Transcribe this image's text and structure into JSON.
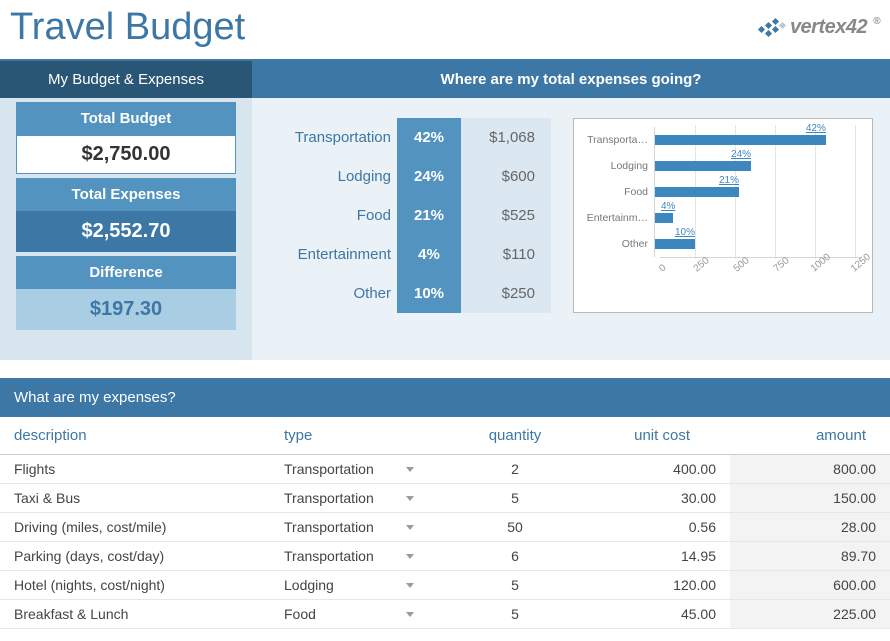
{
  "title": "Travel Budget",
  "logo_text": "vertex42",
  "summary": {
    "panel_title": "My Budget & Expenses",
    "budget_label": "Total Budget",
    "budget_value": "$2,750.00",
    "expenses_label": "Total Expenses",
    "expenses_value": "$2,552.70",
    "difference_label": "Difference",
    "difference_value": "$197.30"
  },
  "breakdown": {
    "title": "Where are my total expenses going?",
    "rows": [
      {
        "label": "Transportation",
        "pct": "42%",
        "amount": "$1,068"
      },
      {
        "label": "Lodging",
        "pct": "24%",
        "amount": "$600"
      },
      {
        "label": "Food",
        "pct": "21%",
        "amount": "$525"
      },
      {
        "label": "Entertainment",
        "pct": "4%",
        "amount": "$110"
      },
      {
        "label": "Other",
        "pct": "10%",
        "amount": "$250"
      }
    ]
  },
  "chart_data": {
    "type": "bar",
    "categories": [
      "Transportation",
      "Lodging",
      "Food",
      "Entertainment",
      "Other"
    ],
    "cat_display": [
      "Transporta…",
      "Lodging",
      "Food",
      "Entertainm…",
      "Other"
    ],
    "values": [
      1068,
      600,
      525,
      110,
      250
    ],
    "bar_labels": [
      "42%",
      "24%",
      "21%",
      "4%",
      "10%"
    ],
    "ticks": [
      0,
      250,
      500,
      750,
      1000,
      1250
    ],
    "xlim": [
      0,
      1250
    ]
  },
  "expenses": {
    "title": "What are my expenses?",
    "columns": {
      "description": "description",
      "type": "type",
      "quantity": "quantity",
      "unit_cost": "unit cost",
      "amount": "amount"
    },
    "rows": [
      {
        "description": "Flights",
        "type": "Transportation",
        "quantity": "2",
        "unit_cost": "400.00",
        "amount": "800.00"
      },
      {
        "description": "Taxi & Bus",
        "type": "Transportation",
        "quantity": "5",
        "unit_cost": "30.00",
        "amount": "150.00"
      },
      {
        "description": "Driving (miles, cost/mile)",
        "type": "Transportation",
        "quantity": "50",
        "unit_cost": "0.56",
        "amount": "28.00"
      },
      {
        "description": "Parking (days, cost/day)",
        "type": "Transportation",
        "quantity": "6",
        "unit_cost": "14.95",
        "amount": "89.70"
      },
      {
        "description": "Hotel (nights, cost/night)",
        "type": "Lodging",
        "quantity": "5",
        "unit_cost": "120.00",
        "amount": "600.00"
      },
      {
        "description": "Breakfast & Lunch",
        "type": "Food",
        "quantity": "5",
        "unit_cost": "45.00",
        "amount": "225.00"
      }
    ]
  }
}
